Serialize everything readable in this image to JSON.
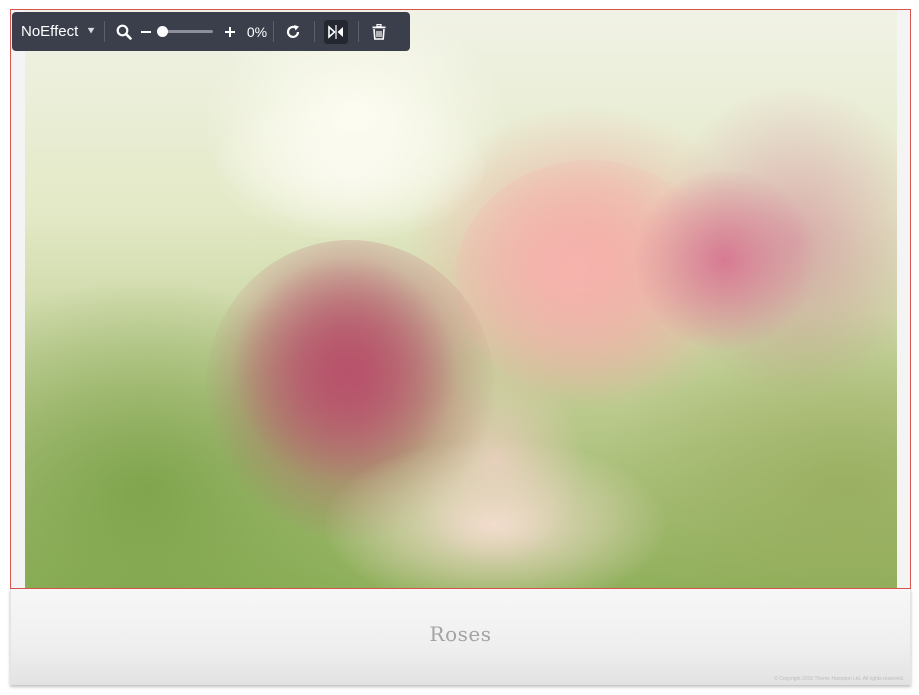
{
  "toolbar": {
    "effect_label": "NoEffect",
    "zoom_value": "0%",
    "zoom_level": 0,
    "icons": {
      "dropdown": "double-chevron-down-icon",
      "zoom": "magnifier-icon",
      "zoom_out": "minus-icon",
      "zoom_in": "plus-icon",
      "rotate": "rotate-icon",
      "flip": "flip-horizontal-icon",
      "delete": "trash-icon"
    }
  },
  "caption": {
    "title": "Roses",
    "copyright": "© Copyright 2015 Theme Hampton Ltd. All rights reserved."
  },
  "colors": {
    "accent_border": "#d9534f",
    "toolbar_bg": "#3a3f4b"
  }
}
